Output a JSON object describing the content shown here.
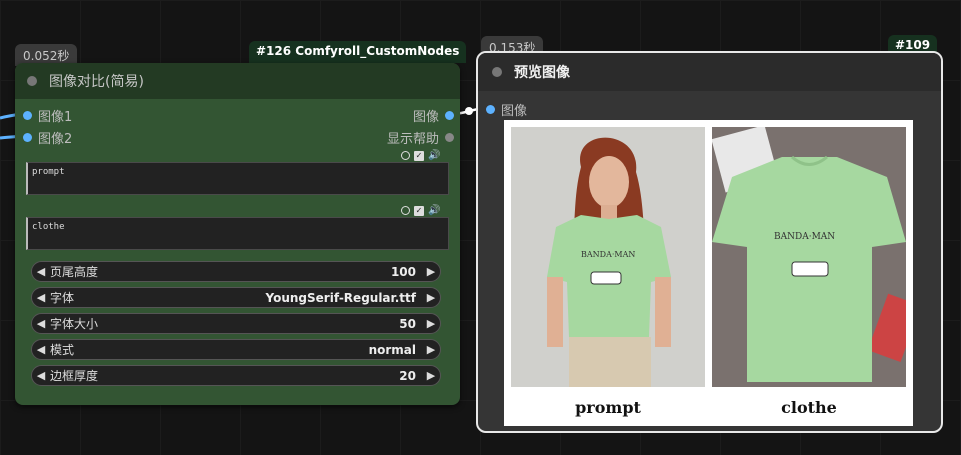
{
  "node_left": {
    "time": "0.052秒",
    "badge": "#126 Comfyroll_CustomNodes",
    "title": "图像对比(简易)",
    "inputs": [
      "图像1",
      "图像2"
    ],
    "outputs": [
      "图像",
      "显示帮助"
    ],
    "text1": "prompt",
    "text2": "clothe",
    "widgets": [
      {
        "label": "页尾高度",
        "value": "100"
      },
      {
        "label": "字体",
        "value": "YoungSerif-Regular.ttf"
      },
      {
        "label": "字体大小",
        "value": "50"
      },
      {
        "label": "模式",
        "value": "normal"
      },
      {
        "label": "边框厚度",
        "value": "20"
      }
    ]
  },
  "node_right": {
    "time": "0.153秒",
    "badge": "#109",
    "title": "预览图像",
    "input": "图像",
    "captions": [
      "prompt",
      "clothe"
    ]
  },
  "colors": {
    "node_green": "#335533",
    "input_slot": "#5db2ff",
    "tshirt": "#a6d8a0"
  }
}
